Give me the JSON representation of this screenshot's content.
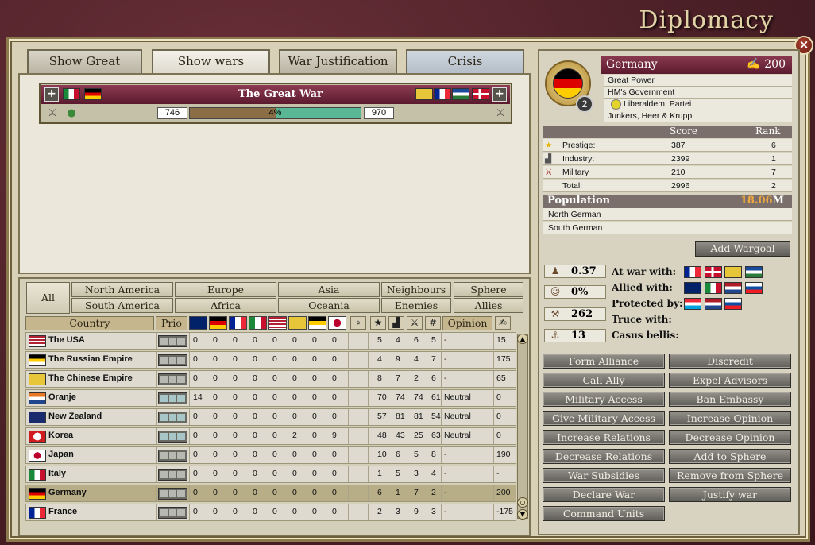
{
  "title": "Diplomacy",
  "close": "×",
  "tabs": [
    "Show Great Powers",
    "Show wars",
    "War Justification",
    "Crisis"
  ],
  "war": {
    "name": "The Great War",
    "attacker_score": "746",
    "defender_score": "970",
    "warscore": "4%",
    "warscore_value": 0.04,
    "plus": "+"
  },
  "filters": {
    "all": "All",
    "row1": [
      "North America",
      "Europe",
      "Asia",
      "Neighbours",
      "Sphere"
    ],
    "row2": [
      "South America",
      "Africa",
      "Oceania",
      "Enemies",
      "Allies"
    ]
  },
  "table": {
    "country_header": "Country",
    "prio_header": "Prio",
    "opinion_header": "Opinion",
    "icon_headers": [
      "#"
    ],
    "rows": [
      {
        "name": "The USA",
        "flag": "usa",
        "prio_lit": false,
        "v": [
          "0",
          "0",
          "0",
          "0",
          "0",
          "0",
          "0",
          "0"
        ],
        "s": [
          "5",
          "4",
          "6",
          "5"
        ],
        "op": "-",
        "inf": "15"
      },
      {
        "name": "The Russian Empire",
        "flag": "russia",
        "prio_lit": false,
        "v": [
          "0",
          "0",
          "0",
          "0",
          "0",
          "0",
          "0",
          "0"
        ],
        "s": [
          "4",
          "9",
          "4",
          "7"
        ],
        "op": "-",
        "inf": "175"
      },
      {
        "name": "The Chinese Empire",
        "flag": "china",
        "prio_lit": false,
        "v": [
          "0",
          "0",
          "0",
          "0",
          "0",
          "0",
          "0",
          "0"
        ],
        "s": [
          "8",
          "7",
          "2",
          "6"
        ],
        "op": "-",
        "inf": "65"
      },
      {
        "name": "Oranje",
        "flag": "oranje",
        "prio_lit": true,
        "v": [
          "14",
          "0",
          "0",
          "0",
          "0",
          "0",
          "0",
          "0"
        ],
        "s": [
          "70",
          "74",
          "74",
          "61"
        ],
        "op": "Neutral",
        "inf": "0"
      },
      {
        "name": "New Zealand",
        "flag": "nz",
        "prio_lit": true,
        "v": [
          "0",
          "0",
          "0",
          "0",
          "0",
          "0",
          "0",
          "0"
        ],
        "s": [
          "57",
          "81",
          "81",
          "54"
        ],
        "op": "Neutral",
        "inf": "0"
      },
      {
        "name": "Korea",
        "flag": "korea",
        "prio_lit": true,
        "v": [
          "0",
          "0",
          "0",
          "0",
          "0",
          "2",
          "0",
          "9"
        ],
        "s": [
          "48",
          "43",
          "25",
          "63"
        ],
        "op": "Neutral",
        "inf": "0"
      },
      {
        "name": "Japan",
        "flag": "japan",
        "prio_lit": false,
        "v": [
          "0",
          "0",
          "0",
          "0",
          "0",
          "0",
          "0",
          "0"
        ],
        "s": [
          "10",
          "6",
          "5",
          "8"
        ],
        "op": "-",
        "inf": "190"
      },
      {
        "name": "Italy",
        "flag": "italy",
        "prio_lit": false,
        "v": [
          "0",
          "0",
          "0",
          "0",
          "0",
          "0",
          "0",
          "0"
        ],
        "s": [
          "1",
          "5",
          "3",
          "4"
        ],
        "op": "-",
        "inf": "-"
      },
      {
        "name": "Germany",
        "flag": "germany",
        "prio_lit": false,
        "v": [
          "0",
          "0",
          "0",
          "0",
          "0",
          "0",
          "0",
          "0"
        ],
        "s": [
          "6",
          "1",
          "7",
          "2"
        ],
        "op": "-",
        "inf": "200"
      },
      {
        "name": "France",
        "flag": "france",
        "prio_lit": false,
        "v": [
          "0",
          "0",
          "0",
          "0",
          "0",
          "0",
          "0",
          "0"
        ],
        "s": [
          "2",
          "3",
          "9",
          "3"
        ],
        "op": "-",
        "inf": "-175"
      }
    ]
  },
  "country": {
    "name": "Germany",
    "influence": "200",
    "rank_badge": "2",
    "status": "Great Power",
    "government": "HM's Government",
    "party": "Liberaldem. Partei",
    "interest": "Junkers, Heer & Krupp",
    "score_header": "Score",
    "rank_header": "Rank",
    "scores": [
      {
        "label": "Prestige:",
        "score": "387",
        "rank": "6"
      },
      {
        "label": "Industry:",
        "score": "2399",
        "rank": "1"
      },
      {
        "label": "Military",
        "score": "210",
        "rank": "7"
      },
      {
        "label": "Total:",
        "score": "2996",
        "rank": "2"
      }
    ],
    "population_label": "Population",
    "population_value": "18.06",
    "population_unit": "M",
    "cultures": [
      "North German",
      "South German"
    ],
    "add_wargoal": "Add Wargoal",
    "stats": [
      "0.37",
      "0%",
      "262",
      "13"
    ],
    "relations": {
      "at_war": "At war with:",
      "allied": "Allied with:",
      "protected": "Protected by:",
      "truce": "Truce with:",
      "casus": "Casus bellis:"
    }
  },
  "actions": [
    [
      "Form Alliance",
      "Discredit"
    ],
    [
      "Call Ally",
      "Expel Advisors"
    ],
    [
      "Military Access",
      "Ban Embassy"
    ],
    [
      "Give Military Access",
      "Increase Opinion"
    ],
    [
      "Increase Relations",
      "Decrease Opinion"
    ],
    [
      "Decrease Relations",
      "Add to Sphere"
    ],
    [
      "War Subsidies",
      "Remove from Sphere"
    ],
    [
      "Declare War",
      "Justify war"
    ],
    [
      "Command Units",
      ""
    ]
  ]
}
